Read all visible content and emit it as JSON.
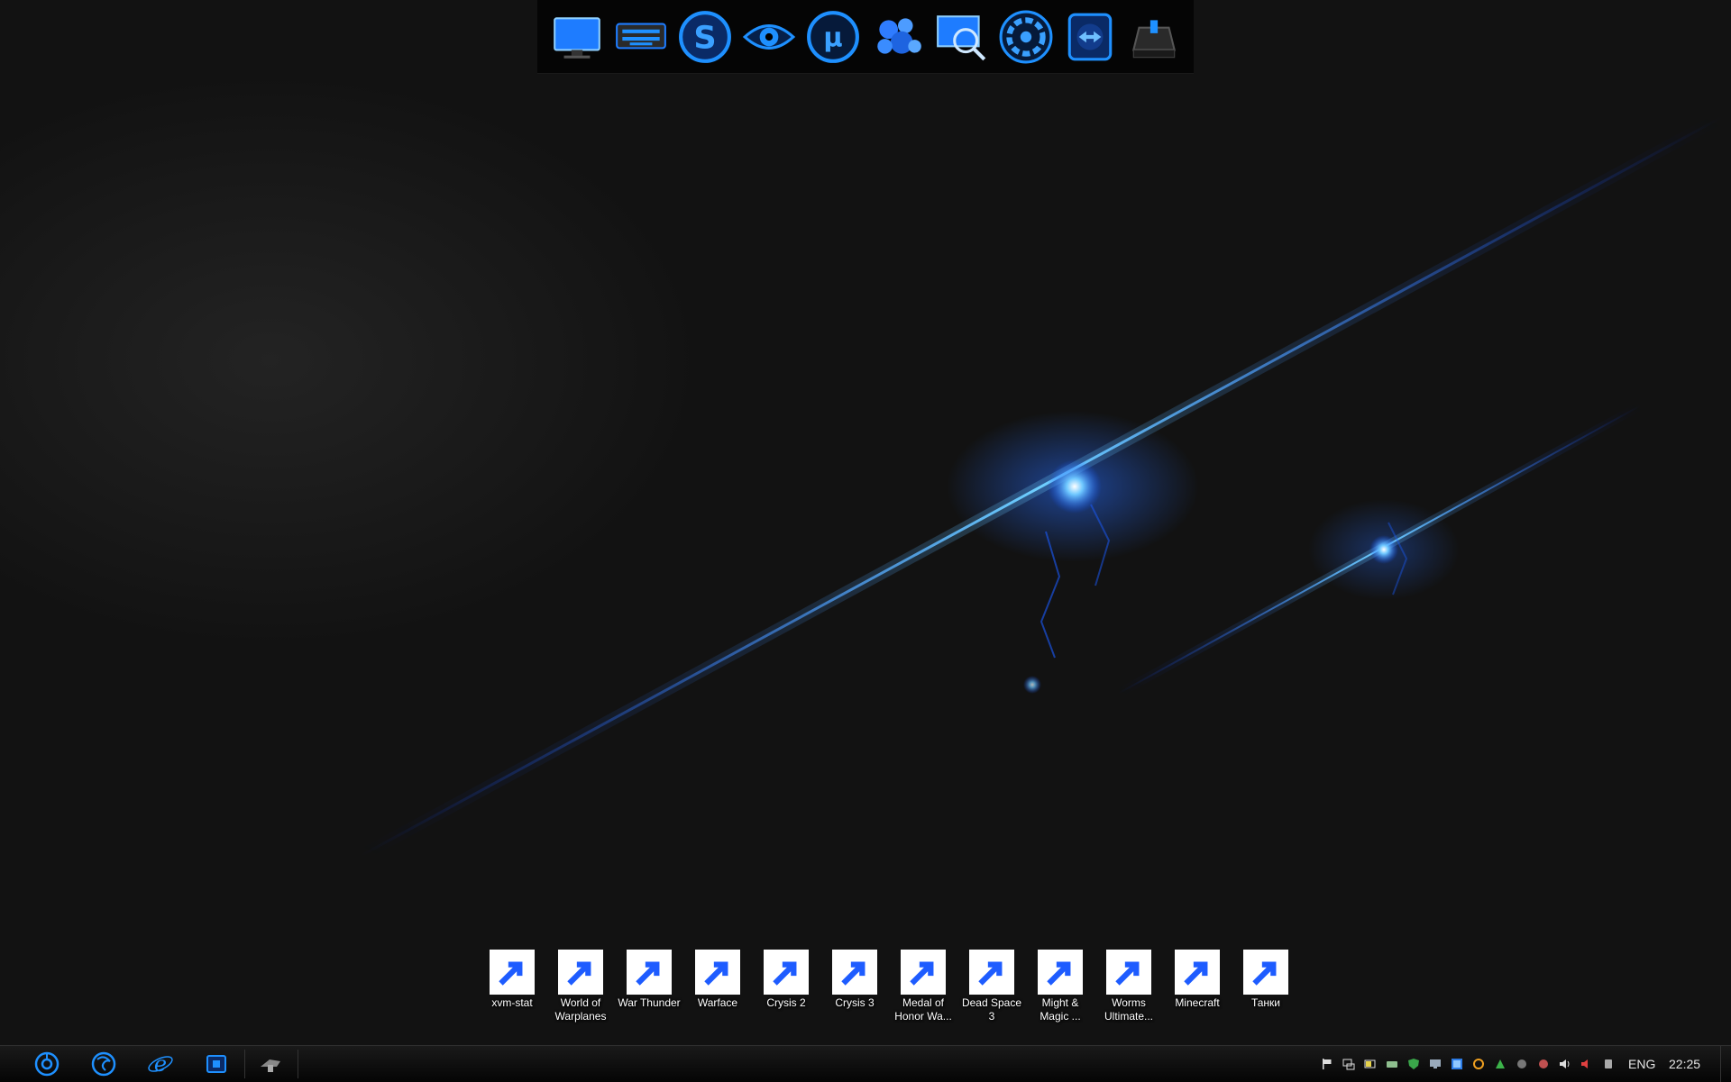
{
  "top_dock": {
    "icons": [
      "monitor-icon",
      "keyboard-icon",
      "skype-icon",
      "eye-icon",
      "utorrent-icon",
      "molecule-icon",
      "magnifier-icon",
      "aperture-icon",
      "teamviewer-icon",
      "drive-icon"
    ]
  },
  "desktop_icons": [
    {
      "label": "xvm-stat",
      "icon": "xvm-stat-icon",
      "color": "#bdbdbd"
    },
    {
      "label": "World of\nWarplanes",
      "icon": "world-of-warplanes-icon",
      "color": "#9fc4e8"
    },
    {
      "label": "War Thunder",
      "icon": "war-thunder-icon",
      "color": "#c23b2e"
    },
    {
      "label": "Warface",
      "icon": "warface-icon",
      "color": "#8a8a8a"
    },
    {
      "label": "Crysis 2",
      "icon": "crysis-2-icon",
      "color": "#6f7f8c"
    },
    {
      "label": "Crysis 3",
      "icon": "crysis-3-icon",
      "color": "#7a6a5c"
    },
    {
      "label": "Medal of\nHonor Wa...",
      "icon": "medal-of-honor-icon",
      "color": "#cfcfcf"
    },
    {
      "label": "Dead Space 3",
      "icon": "dead-space-3-icon",
      "color": "#c79a6e"
    },
    {
      "label": "Might &\nMagic ...",
      "icon": "might-and-magic-icon",
      "color": "#d8a62e"
    },
    {
      "label": "Worms\nUltimate...",
      "icon": "worms-ultimate-icon",
      "color": "#5aa63a"
    },
    {
      "label": "Minecraft",
      "icon": "minecraft-icon",
      "color": "#1e90ff"
    },
    {
      "label": "Танки",
      "icon": "tanki-icon",
      "color": "#1e90ff"
    }
  ],
  "taskbar": {
    "pinned": [
      "chrome-icon",
      "firefox-icon",
      "internet-explorer-icon",
      "windows-explorer-icon",
      "sniper-app-icon"
    ],
    "tray_icons": [
      "flag-icon",
      "network-icon",
      "battery-icon",
      "device-icon",
      "shield-icon",
      "display-icon",
      "update-icon",
      "sync-icon",
      "connection-icon",
      "antivirus-icon",
      "volume-icon",
      "mute-speaker-icon",
      "app-tray-icon",
      "safely-remove-icon"
    ],
    "language": "ENG",
    "clock": "22:25"
  },
  "colors": {
    "accent": "#1e90ff",
    "wallpaper": "#141414",
    "taskbar": "#0a0a0a"
  }
}
